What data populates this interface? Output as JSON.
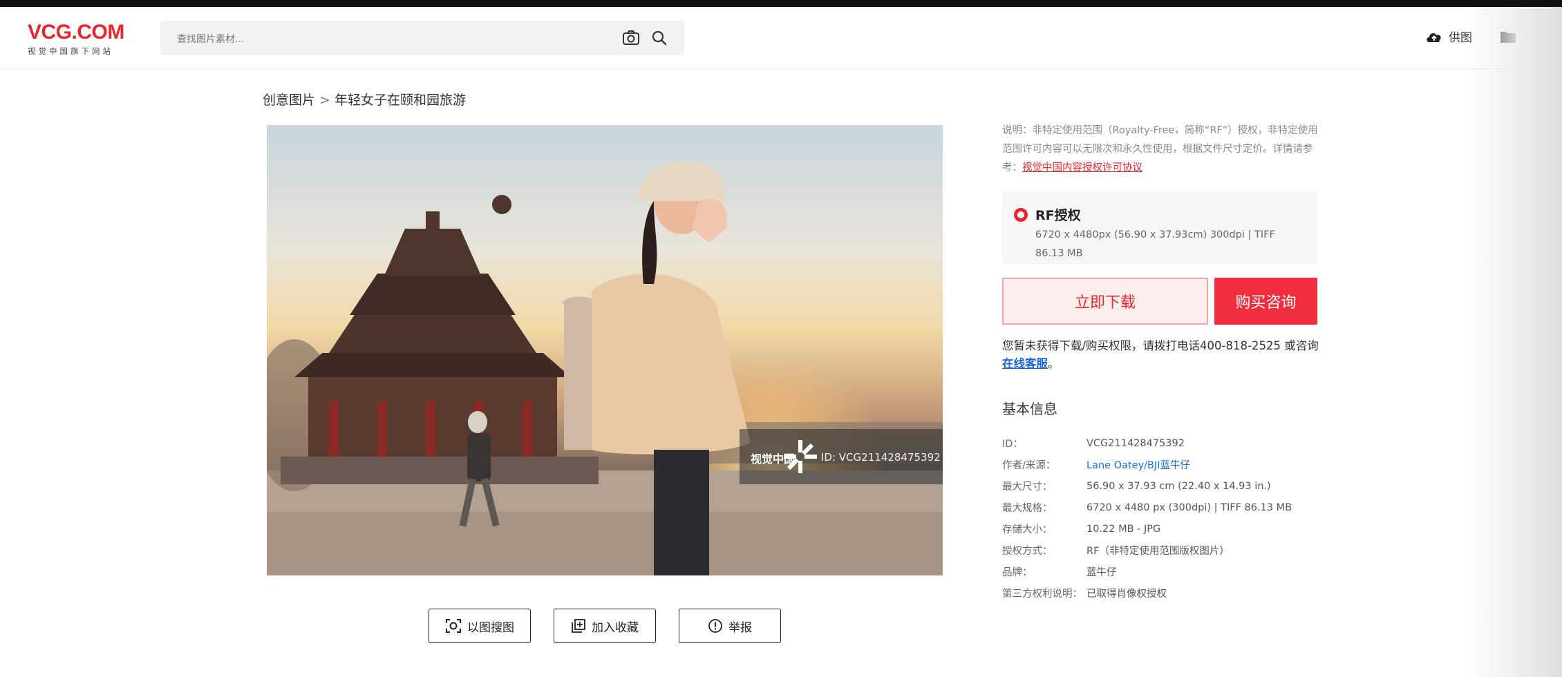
{
  "header": {
    "logo_text": "VCG.COM",
    "logo_subtitle": "视觉中国旗下网站",
    "search_placeholder": "查找图片素材...",
    "supply_label": "供图",
    "favorites_label": "收藏夹"
  },
  "breadcrumb": {
    "root": "创意图片",
    "separator": ">",
    "current": "年轻女子在颐和园旅游"
  },
  "image": {
    "watermark_logo": "视觉中国",
    "watermark_id": "ID: VCG211428475392"
  },
  "image_actions": {
    "search_by_image": "以图搜图",
    "add_favorite": "加入收藏",
    "report": "举报"
  },
  "license_notice": {
    "text": "说明：非特定使用范围（Royalty-Free，简称“RF”）授权，非特定使用范围许可内容可以无限次和永久性使用，根据文件尺寸定价。详情请参考：",
    "link": "视觉中国内容授权许可协议"
  },
  "license_option": {
    "title": "RF授权",
    "spec": "6720 x 4480px (56.90 x 37.93cm) 300dpi | TIFF 86.13 MB",
    "selected": true
  },
  "buttons": {
    "download": "立即下载",
    "consult": "购买咨询"
  },
  "permission_note": {
    "text": "您暂未获得下载/购买权限，请拨打电话400-818-2525 或咨询",
    "link": "在线客服",
    "end": "。"
  },
  "basic_info": {
    "heading": "基本信息",
    "rows": [
      {
        "key": "ID：",
        "value": "VCG211428475392"
      },
      {
        "key": "作者/来源：",
        "value": "Lane Oatey/BJI蓝牛仔"
      },
      {
        "key": "最大尺寸：",
        "value": "56.90 x 37.93 cm (22.40 x 14.93 in.)"
      },
      {
        "key": "最大规格：",
        "value": "6720 x 4480 px (300dpi) | TIFF 86.13 MB"
      },
      {
        "key": "存储大小：",
        "value": "10.22 MB - JPG"
      },
      {
        "key": "授权方式：",
        "value": "RF（非特定使用范围版权图片）"
      },
      {
        "key": "品牌：",
        "value": "蓝牛仔"
      },
      {
        "key": "第三方权利说明：",
        "value": "已取得肖像权授权"
      }
    ]
  },
  "colors": {
    "brand_red": "#e8262f",
    "link_blue": "#1a6fd6"
  }
}
